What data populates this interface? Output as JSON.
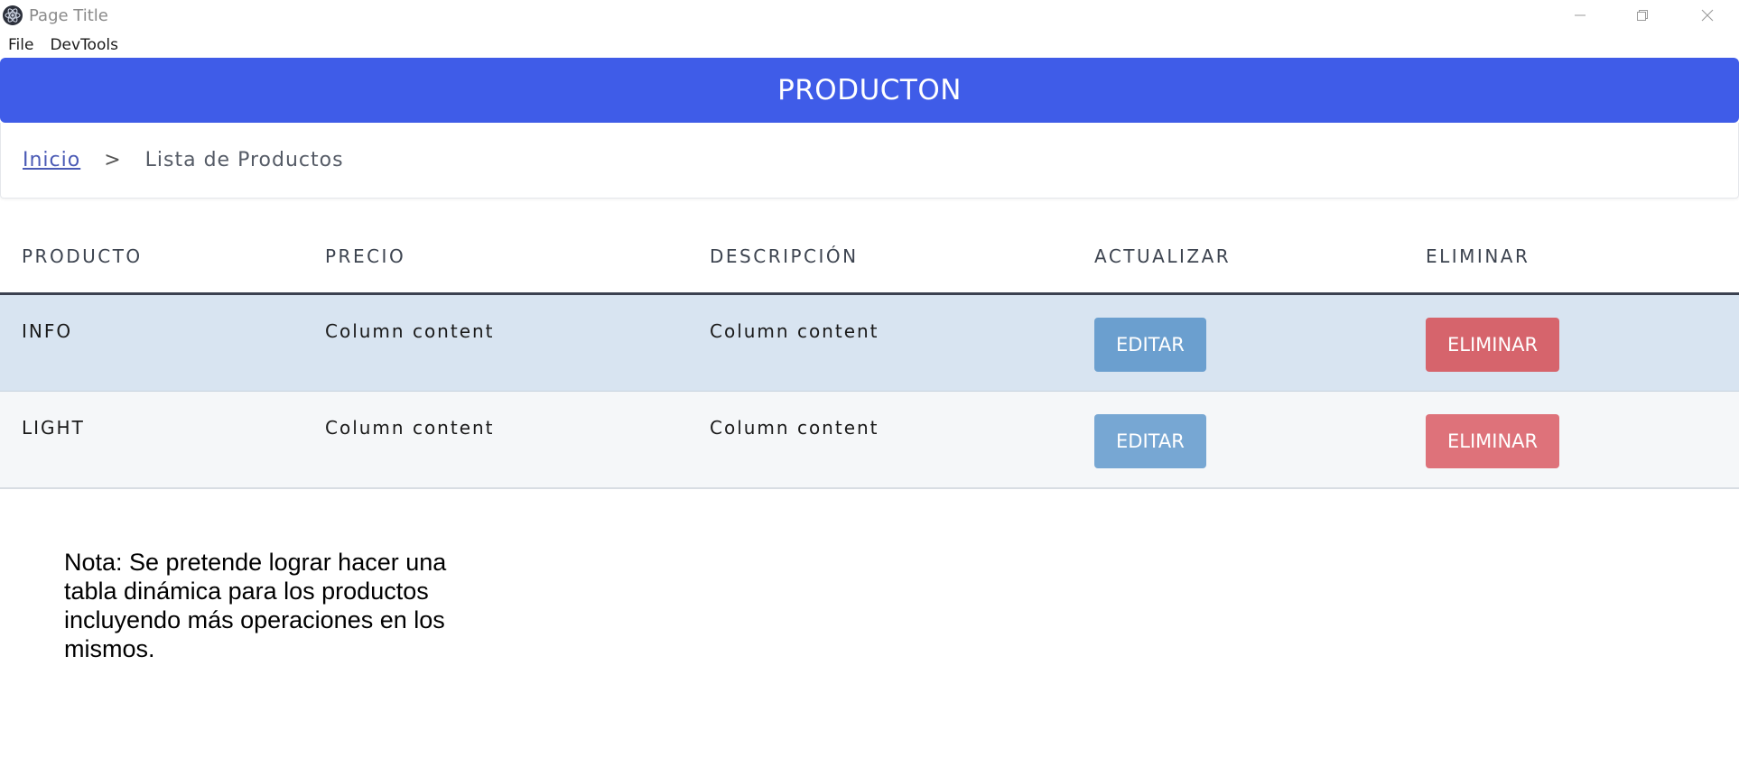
{
  "window": {
    "title": "Page Title"
  },
  "menubar": {
    "items": [
      "File",
      "DevTools"
    ]
  },
  "header": {
    "title": "PRODUCTON",
    "background": "#3f5ce8"
  },
  "breadcrumb": {
    "home": "Inicio",
    "separator": ">",
    "current": "Lista de Productos"
  },
  "table": {
    "headers": [
      "PRODUCTO",
      "PRECIO",
      "DESCRIPCIÓN",
      "ACTUALIZAR",
      "ELIMINAR"
    ],
    "rows": [
      {
        "producto": "INFO",
        "precio": "Column content",
        "descripcion": "Column content",
        "edit_label": "EDITAR",
        "delete_label": "ELIMINAR",
        "background": "#d8e4f1"
      },
      {
        "producto": "LIGHT",
        "precio": "Column content",
        "descripcion": "Column content",
        "edit_label": "EDITAR",
        "delete_label": "ELIMINAR",
        "background": "#f5f7f9"
      }
    ]
  },
  "colors": {
    "edit_button": "#6b9fcf",
    "delete_button": "#d6646c"
  },
  "note": {
    "text": "Nota: Se pretende lograr hacer una tabla dinámica para los productos incluyendo más operaciones en los mismos."
  }
}
